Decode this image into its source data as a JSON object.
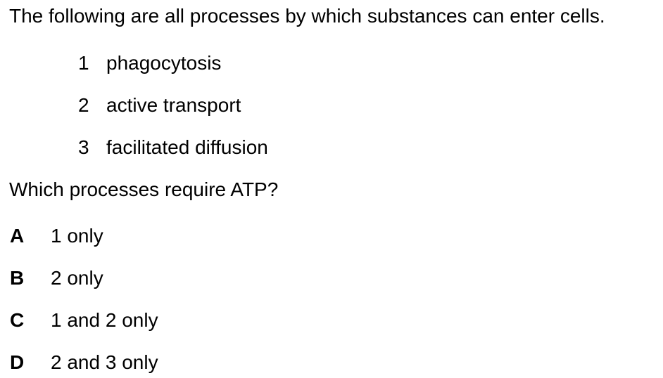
{
  "intro": "The following are all processes by which substances can enter cells.",
  "processes": [
    {
      "number": "1",
      "text": "phagocytosis"
    },
    {
      "number": "2",
      "text": "active transport"
    },
    {
      "number": "3",
      "text": "facilitated diffusion"
    }
  ],
  "question": "Which processes require ATP?",
  "options": [
    {
      "letter": "A",
      "text": "1 only"
    },
    {
      "letter": "B",
      "text": "2 only"
    },
    {
      "letter": "C",
      "text": "1 and 2 only"
    },
    {
      "letter": "D",
      "text": "2 and 3 only"
    }
  ]
}
